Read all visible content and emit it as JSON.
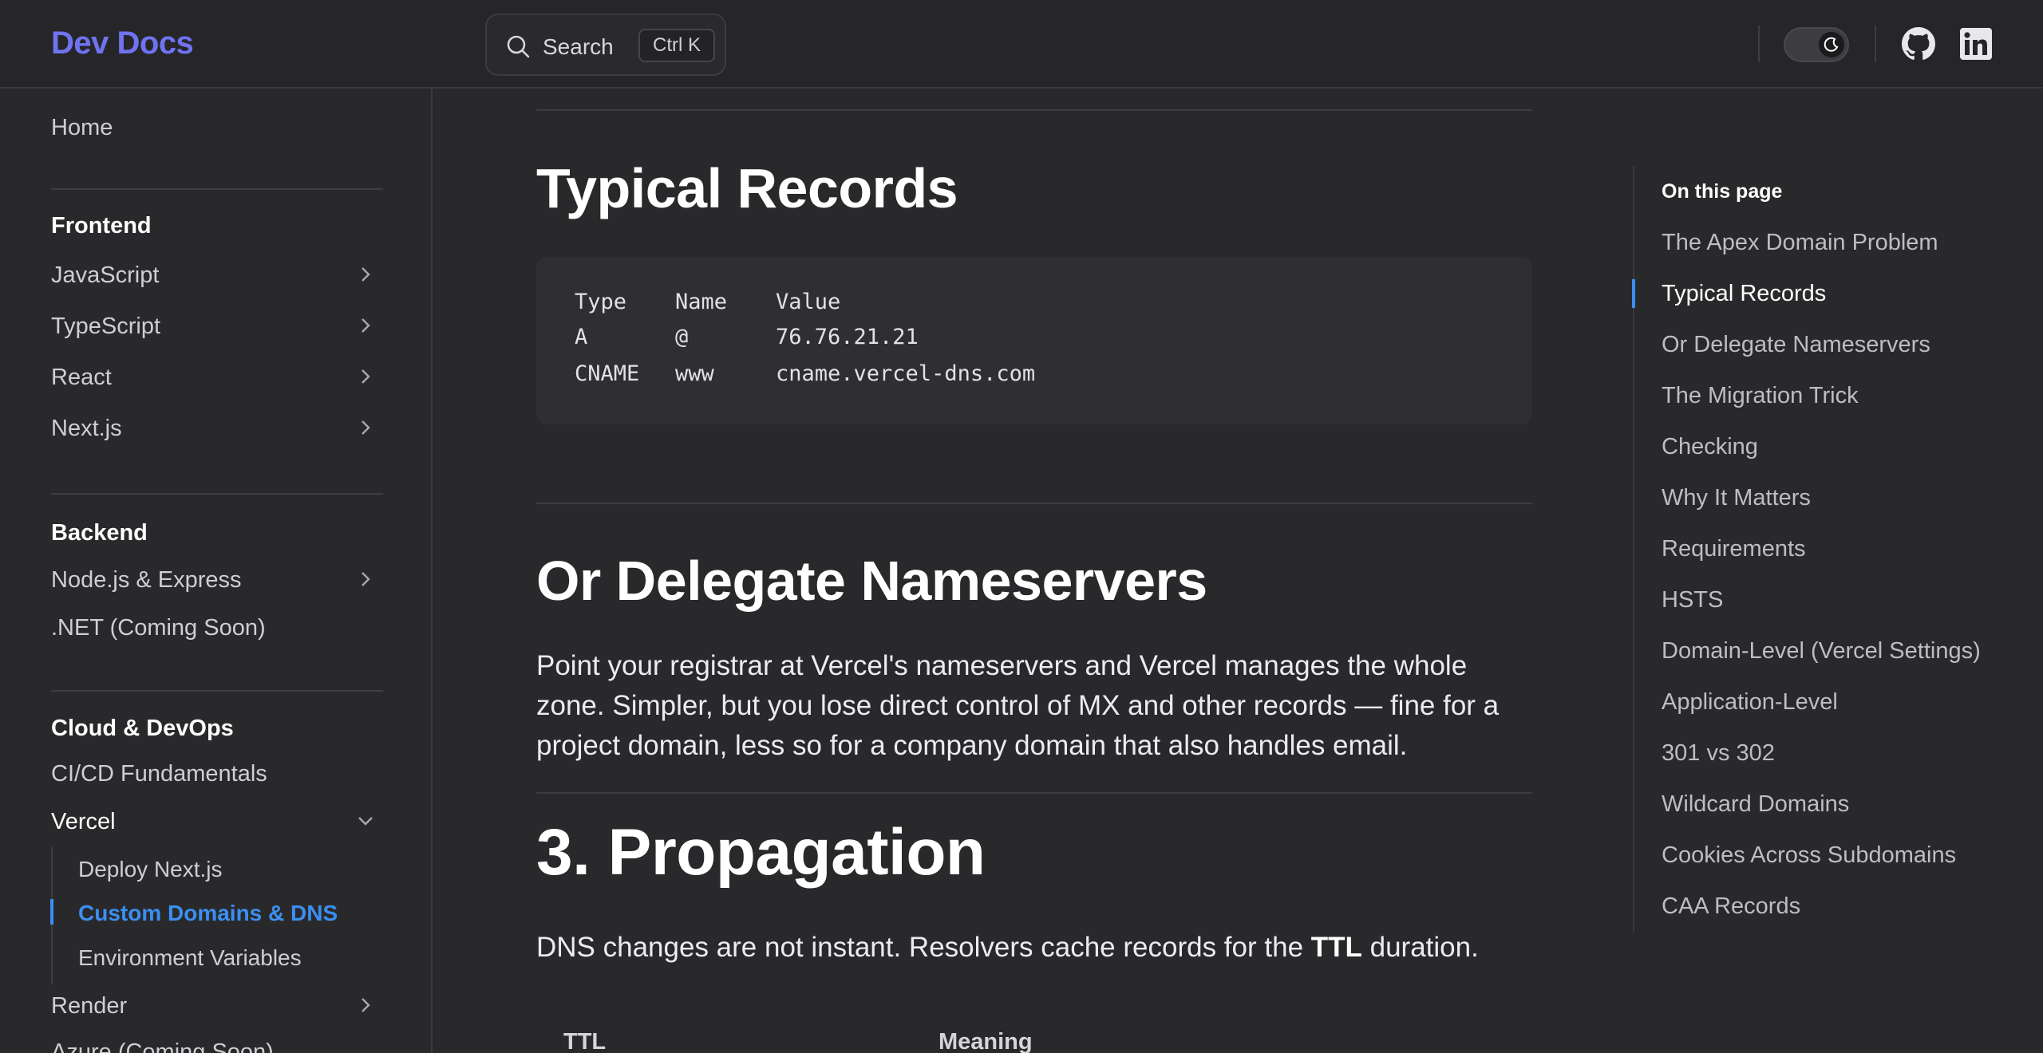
{
  "header": {
    "logo": "Dev Docs",
    "search_label": "Search",
    "search_shortcut": "Ctrl K",
    "theme_toggle_icon": "moon-icon",
    "github_icon": "github-icon",
    "linkedin_icon": "linkedin-icon"
  },
  "sidebar": {
    "home": "Home",
    "sections": [
      {
        "title": "Frontend",
        "items": [
          "JavaScript",
          "TypeScript",
          "React",
          "Next.js"
        ]
      },
      {
        "title": "Backend",
        "items": [
          "Node.js & Express",
          ".NET (Coming Soon)"
        ]
      },
      {
        "title": "Cloud & DevOps",
        "items": [
          "CI/CD Fundamentals",
          "Vercel",
          "Render",
          "Azure (Coming Soon)"
        ]
      }
    ],
    "vercel_children": [
      "Deploy Next.js",
      "Custom Domains & DNS",
      "Environment Variables"
    ],
    "active_item": "Custom Domains & DNS"
  },
  "main": {
    "typical_records_heading": "Typical Records",
    "code": {
      "header": [
        "Type",
        "Name",
        "Value"
      ],
      "rows": [
        [
          "A",
          "@",
          "76.76.21.21"
        ],
        [
          "CNAME",
          "www",
          "cname.vercel-dns.com"
        ]
      ]
    },
    "delegate_heading": "Or Delegate Nameservers",
    "delegate_paragraph": "Point your registrar at Vercel's nameservers and Vercel manages the whole zone. Simpler, but you lose direct control of MX and other records — fine for a project domain, less so for a company domain that also handles email.",
    "propagation_heading": "3. Propagation",
    "propagation_text_before": "DNS changes are not instant. Resolvers cache records for the ",
    "propagation_text_bold": "TTL",
    "propagation_text_after": " duration.",
    "table_headers": [
      "TTL",
      "Meaning"
    ]
  },
  "toc": {
    "title": "On this page",
    "items": [
      "The Apex Domain Problem",
      "Typical Records",
      "Or Delegate Nameservers",
      "The Migration Trick",
      "Checking",
      "Why It Matters",
      "Requirements",
      "HSTS",
      "Domain-Level (Vercel Settings)",
      "Application-Level",
      "301 vs 302",
      "Wildcard Domains",
      "Cookies Across Subdomains",
      "CAA Records"
    ],
    "active_item": "Typical Records"
  },
  "colors": {
    "background": "#29292c",
    "brand": "#6f73f0",
    "accent": "#3b8ff0"
  }
}
